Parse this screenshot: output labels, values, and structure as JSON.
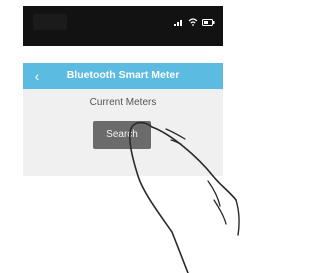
{
  "header": {
    "title": "Bluetooth Smart Meter",
    "back_icon": "chevron-left-icon"
  },
  "content": {
    "section_label": "Current Meters",
    "search_button_label": "Search"
  },
  "status_bar": {
    "icons": [
      "signal-icon",
      "wifi-icon",
      "battery-icon"
    ]
  },
  "colors": {
    "header_bg": "#5bbbe0",
    "status_bg": "#121212",
    "content_bg": "#f0f0f0",
    "button_bg": "#6b6b6b"
  }
}
